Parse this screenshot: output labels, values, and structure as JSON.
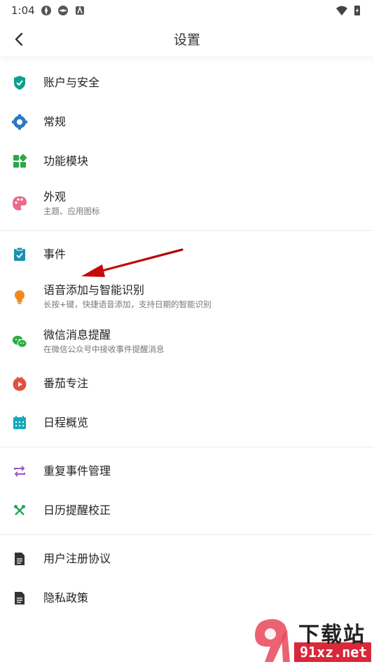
{
  "status_bar": {
    "time": "1:04",
    "icons": [
      "app-icon",
      "app-icon",
      "notification-icon",
      "wifi-icon",
      "battery-icon"
    ]
  },
  "header": {
    "title": "设置",
    "back_icon": "back-arrow-icon"
  },
  "sections": [
    {
      "items": [
        {
          "label": "账户与安全",
          "icon": "shield-icon",
          "color": "#0e9f8e"
        },
        {
          "label": "常规",
          "icon": "gear-icon",
          "color": "#2d78c4"
        },
        {
          "label": "功能模块",
          "icon": "modules-icon",
          "color": "#2aa84a"
        },
        {
          "label": "外观",
          "sub": "主题、应用图标",
          "icon": "palette-icon",
          "color": "#e86b8a"
        }
      ]
    },
    {
      "items": [
        {
          "label": "事件",
          "icon": "clipboard-check-icon",
          "color": "#1c8fb0"
        },
        {
          "label": "语音添加与智能识别",
          "sub": "长按+键，快捷语音添加，支持日期的智能识别",
          "icon": "bulb-icon",
          "color": "#f2891f"
        },
        {
          "label": "微信消息提醒",
          "sub": "在微信公众号中接收事件提醒消息",
          "icon": "wechat-icon",
          "color": "#2aae3f"
        },
        {
          "label": "番茄专注",
          "icon": "tomato-icon",
          "color": "#e0503c"
        },
        {
          "label": "日程概览",
          "icon": "calendar-icon",
          "color": "#16a9b8"
        }
      ]
    },
    {
      "items": [
        {
          "label": "重复事件管理",
          "icon": "repeat-icon",
          "color": "#9b59c4"
        },
        {
          "label": "日历提醒校正",
          "icon": "tools-icon",
          "color": "#26a35a"
        }
      ]
    },
    {
      "items": [
        {
          "label": "用户注册协议",
          "icon": "document-icon",
          "color": "#333333"
        },
        {
          "label": "隐私政策",
          "icon": "document-icon",
          "color": "#333333"
        }
      ]
    }
  ],
  "watermark": {
    "text_top": "下载站",
    "text_bottom": "91xz.net"
  }
}
